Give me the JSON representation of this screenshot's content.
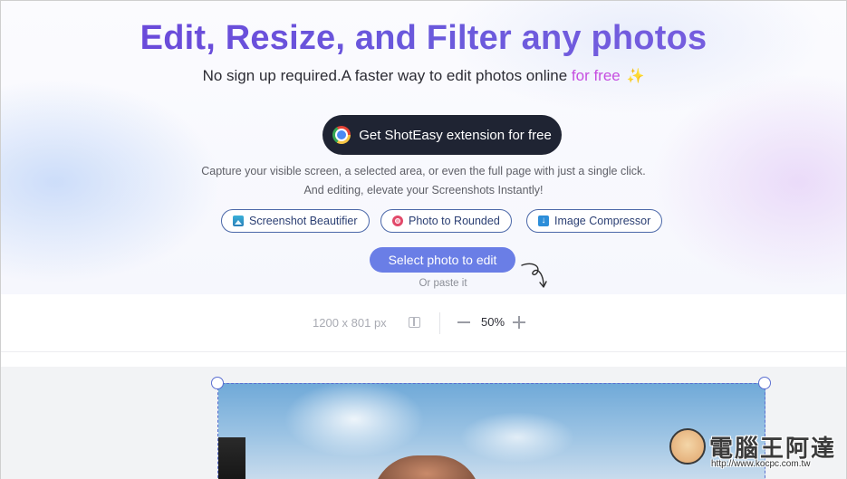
{
  "hero": {
    "title": "Edit, Resize, and Filter any photos",
    "subtitle_main": "No sign up required.A faster way to edit photos online ",
    "subtitle_highlight": "for free",
    "sparkle": "✨",
    "extension_button": "Get ShotEasy extension for free",
    "description_line1": "Capture your visible screen, a selected area, or even the full page with just a single click.",
    "description_line2": "And editing, elevate your Screenshots Instantly!",
    "tools": [
      {
        "label": "Screenshot Beautifier",
        "icon": "image-icon"
      },
      {
        "label": "Photo to Rounded",
        "icon": "lifebuoy-icon"
      },
      {
        "label": "Image Compressor",
        "icon": "download-icon"
      }
    ],
    "select_button": "Select photo to edit",
    "paste_hint": "Or paste it"
  },
  "toolbar": {
    "dimensions": "1200 x 801 px",
    "zoom": "50%"
  },
  "watermark": {
    "text": "電腦王阿達",
    "url": "http://www.kocpc.com.tw"
  },
  "colors": {
    "title_gradient_start": "#6a43d9",
    "highlight": "#c64fe0",
    "dark_button": "#1f2433",
    "primary_button": "#6a7ee6",
    "crop_frame": "#5b6fd1"
  }
}
